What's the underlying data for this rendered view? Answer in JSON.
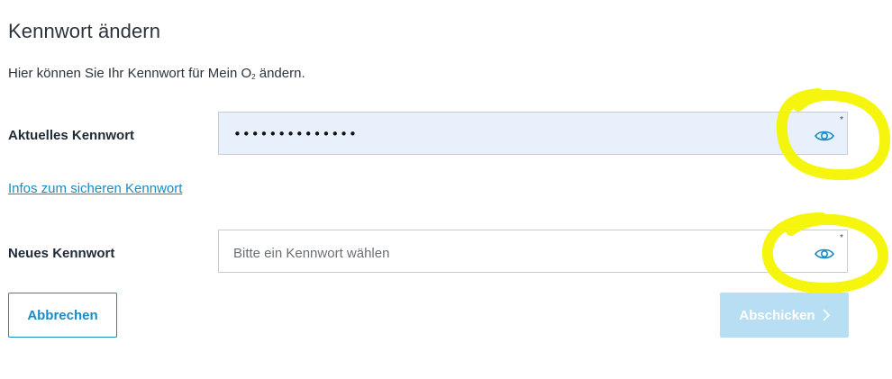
{
  "page": {
    "title": "Kennwort ändern",
    "intro_prefix": "Hier können Sie Ihr Kennwort für Mein O",
    "intro_sub": "2",
    "intro_suffix": " ändern."
  },
  "current_password": {
    "label": "Aktuelles Kennwort",
    "value": "••••••••••••••",
    "required": "*",
    "toggle_icon": "eye-icon"
  },
  "help_link": {
    "text": "Infos zum sicheren Kennwort"
  },
  "new_password": {
    "label": "Neues Kennwort",
    "placeholder": "Bitte ein Kennwort wählen",
    "required": "*",
    "toggle_icon": "eye-icon"
  },
  "actions": {
    "cancel_label": "Abbrechen",
    "submit_label": "Abschicken",
    "submit_icon": "chevron-right-icon"
  },
  "colors": {
    "accent": "#1a8bc6",
    "autofill_bg": "#e8f0fc",
    "submit_disabled_bg": "#b7def2",
    "highlight": "#f4f400"
  }
}
